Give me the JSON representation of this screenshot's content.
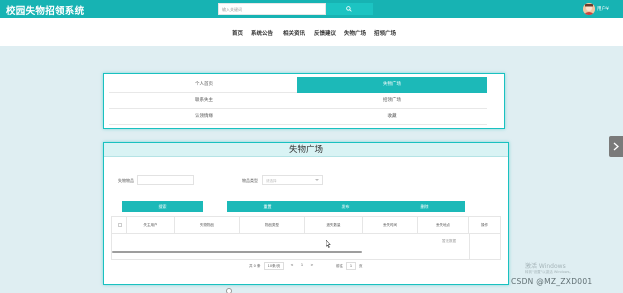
{
  "header": {
    "brand": "校园失物招领系统",
    "search_placeholder": "输入关键词",
    "user_label": "用户¥"
  },
  "nav": {
    "items": [
      "首页",
      "系统公告",
      "相关资讯",
      "反馈建议",
      "失物广场",
      "招领广场"
    ]
  },
  "menu": {
    "items": [
      "个人首页",
      "失物广场",
      "联系失主",
      "招领广场",
      "认领情缘",
      "收藏"
    ],
    "active": "失物广场"
  },
  "main": {
    "title": "失物广场",
    "filters": {
      "name_label": "失物物品",
      "type_label": "物品类型",
      "type_placeholder": "请选择"
    },
    "buttons": [
      "搜索",
      "重置",
      "发布",
      "删除"
    ],
    "columns": [
      "失主用户",
      "失物物品",
      "物品类型",
      "遗失数量",
      "丢失时间",
      "丢失地点",
      "操作"
    ],
    "empty_text": "暂无数据",
    "pager": {
      "total": "共 0 条",
      "page_size": "10条/页",
      "prev": "<",
      "page": "1",
      "next": ">",
      "goto_label": "前往",
      "goto_value": "1",
      "goto_suffix": "页"
    }
  },
  "watermark": {
    "title": "激活 Windows",
    "subtitle": "转到\"设置\"以激活 Windows。",
    "csdn": "CSDN @MZ_ZXD001"
  },
  "colors": {
    "accent": "#1cb9b8",
    "topbar": "#17b3b3",
    "background": "#dfeef2"
  }
}
